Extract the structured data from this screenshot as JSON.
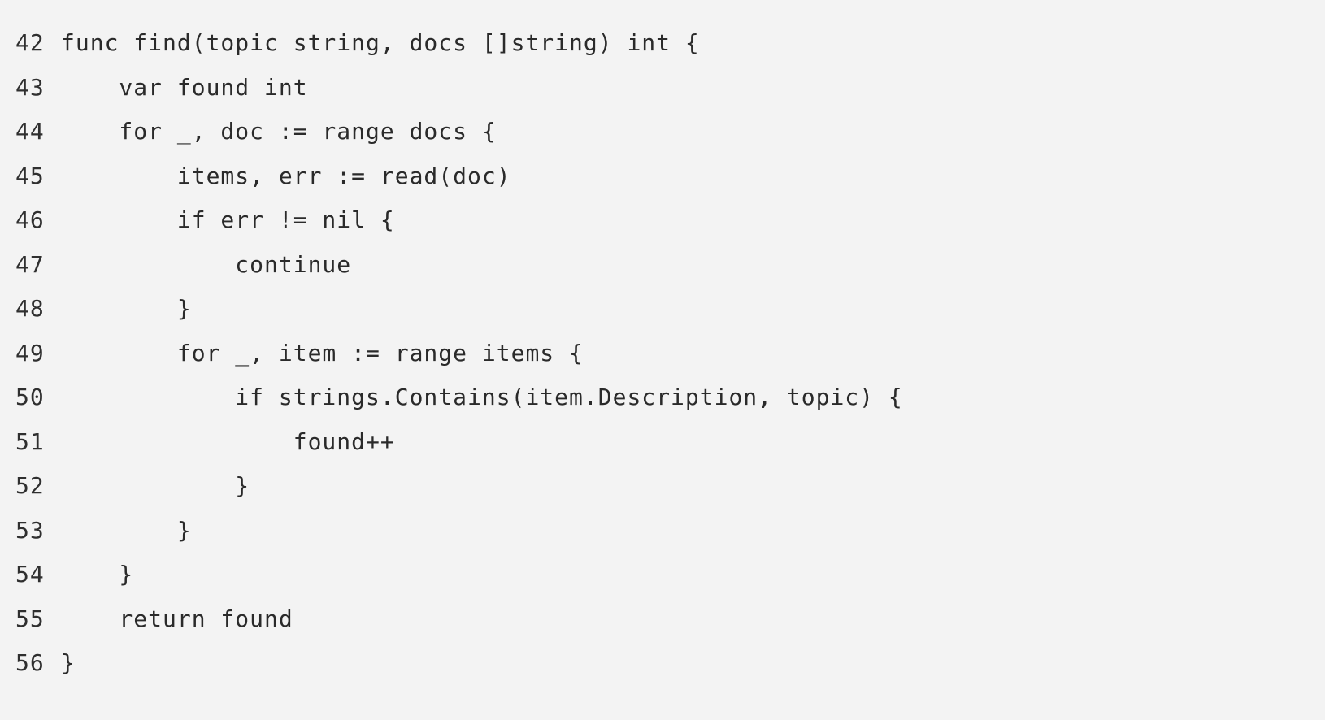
{
  "code": {
    "lines": [
      {
        "number": "42",
        "text": "func find(topic string, docs []string) int {"
      },
      {
        "number": "43",
        "text": "    var found int"
      },
      {
        "number": "44",
        "text": "    for _, doc := range docs {"
      },
      {
        "number": "45",
        "text": "        items, err := read(doc)"
      },
      {
        "number": "46",
        "text": "        if err != nil {"
      },
      {
        "number": "47",
        "text": "            continue"
      },
      {
        "number": "48",
        "text": "        }"
      },
      {
        "number": "49",
        "text": "        for _, item := range items {"
      },
      {
        "number": "50",
        "text": "            if strings.Contains(item.Description, topic) {"
      },
      {
        "number": "51",
        "text": "                found++"
      },
      {
        "number": "52",
        "text": "            }"
      },
      {
        "number": "53",
        "text": "        }"
      },
      {
        "number": "54",
        "text": "    }"
      },
      {
        "number": "55",
        "text": "    return found"
      },
      {
        "number": "56",
        "text": "}"
      }
    ]
  }
}
